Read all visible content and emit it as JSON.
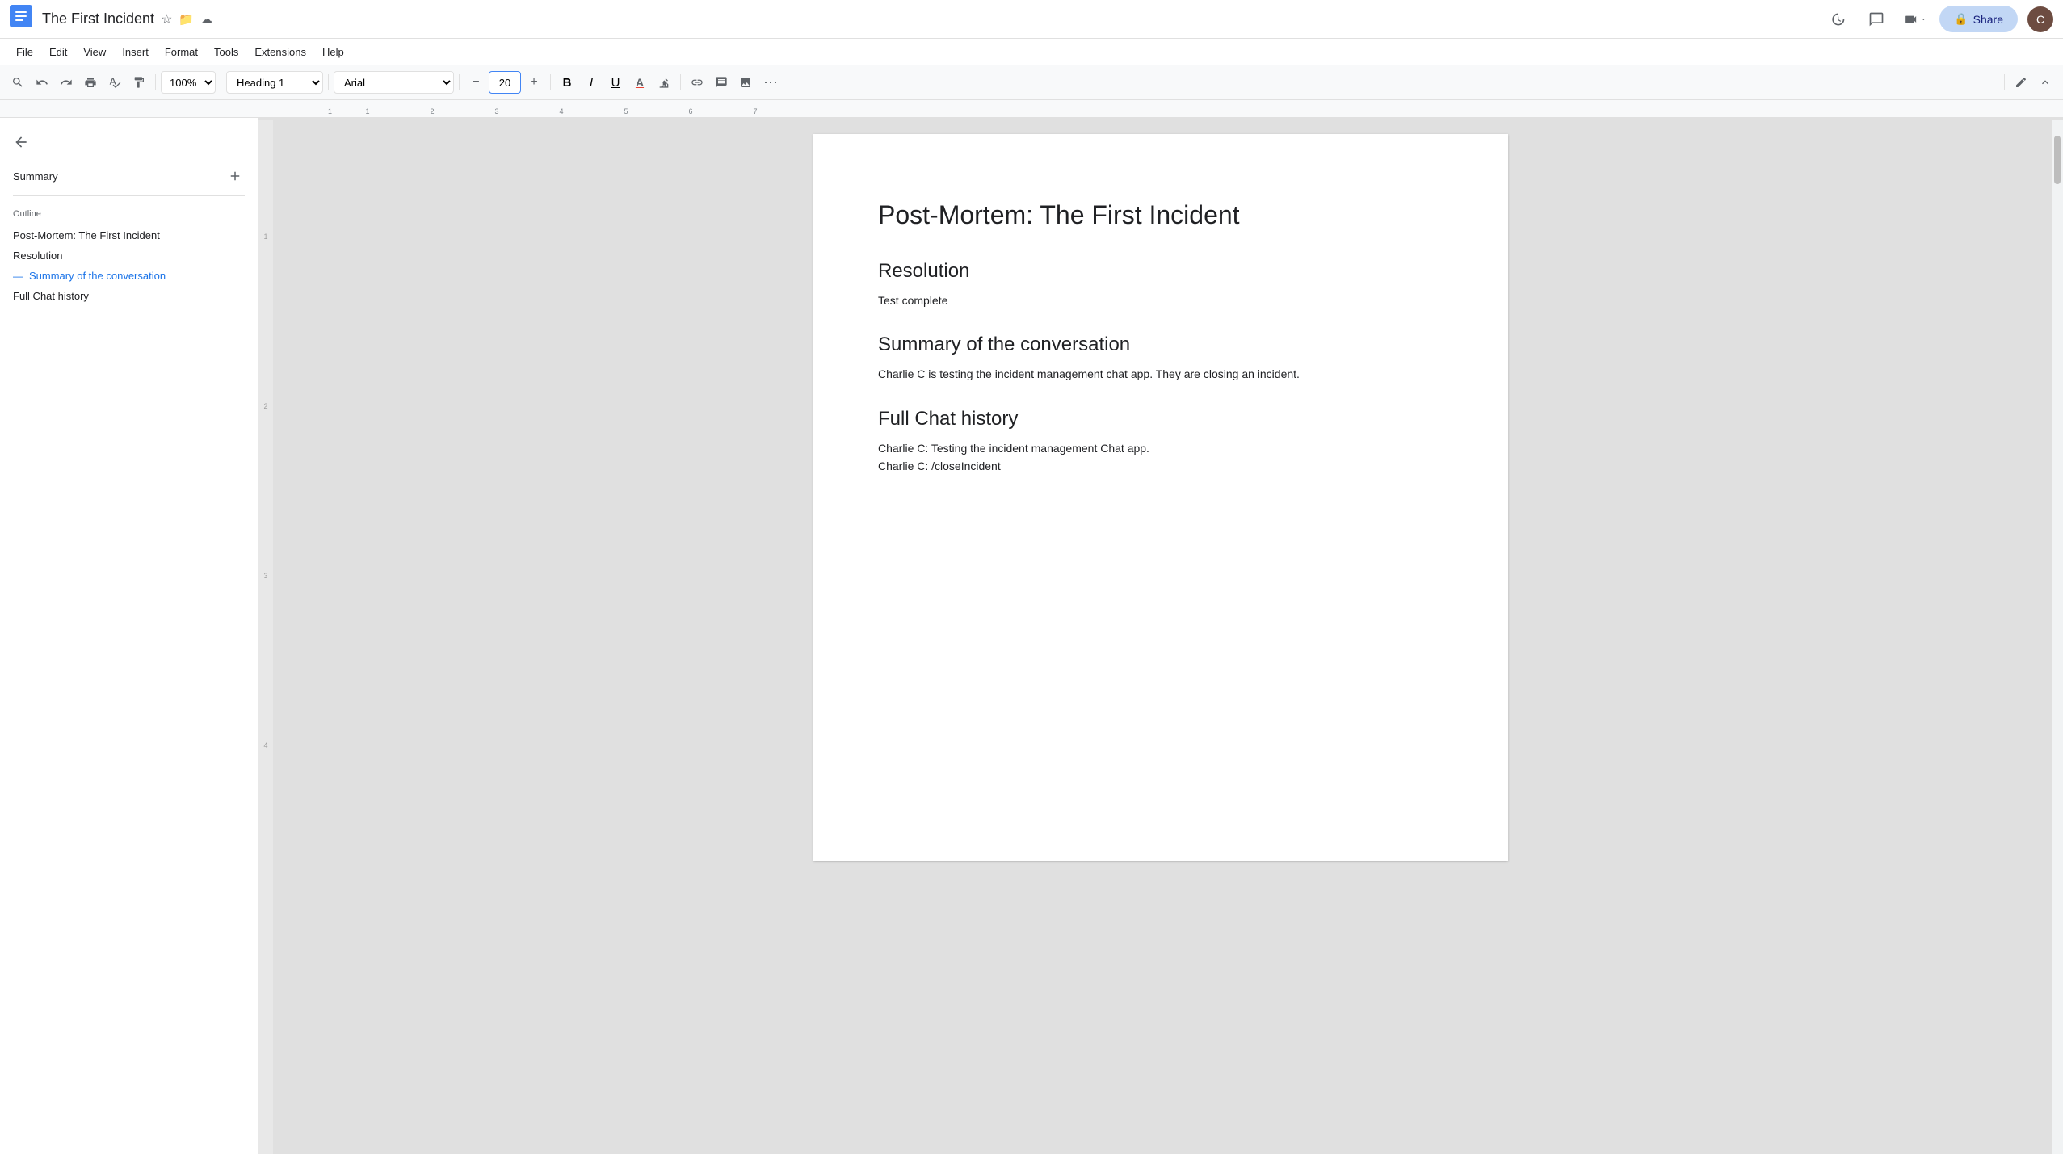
{
  "titlebar": {
    "doc_icon": "📄",
    "title": "The First Incident",
    "star_label": "☆",
    "folder_label": "📁",
    "cloud_label": "☁",
    "history_icon": "history",
    "comment_icon": "comment",
    "video_icon": "videocam",
    "share_label": "Share",
    "lock_icon": "🔒"
  },
  "menubar": {
    "items": [
      "File",
      "Edit",
      "View",
      "Insert",
      "Format",
      "Tools",
      "Extensions",
      "Help"
    ]
  },
  "toolbar": {
    "search_icon": "🔍",
    "undo_icon": "↩",
    "redo_icon": "↪",
    "print_icon": "🖨",
    "spellcheck_icon": "abc",
    "paint_icon": "🖌",
    "zoom_value": "100%",
    "style_value": "Heading 1",
    "font_value": "Arial",
    "font_size_value": "20",
    "decrease_font_icon": "−",
    "increase_font_icon": "+",
    "bold_label": "B",
    "italic_label": "I",
    "underline_label": "U",
    "text_color_icon": "A",
    "highlight_icon": "✏",
    "link_icon": "🔗",
    "comment_icon": "💬",
    "image_icon": "🖼",
    "more_icon": "⋯",
    "edit_icon": "✏",
    "collapse_icon": "⌃"
  },
  "sidebar": {
    "back_icon": "←",
    "summary_label": "Summary",
    "add_icon": "+",
    "outline_label": "Outline",
    "outline_items": [
      {
        "id": "post-mortem",
        "label": "Post-Mortem: The First Incident",
        "active": false
      },
      {
        "id": "resolution",
        "label": "Resolution",
        "active": false
      },
      {
        "id": "summary-conv",
        "label": "Summary of the conversation",
        "active": true
      },
      {
        "id": "full-chat",
        "label": "Full Chat history",
        "active": false
      }
    ]
  },
  "document": {
    "title": "Post-Mortem: The First Incident",
    "sections": [
      {
        "id": "resolution",
        "heading": "Resolution",
        "body": "Test complete"
      },
      {
        "id": "summary-conversation",
        "heading": "Summary of the conversation",
        "body": "Charlie C is testing the incident management chat app. They are closing an incident."
      },
      {
        "id": "full-chat-history",
        "heading": "Full Chat history",
        "lines": [
          "Charlie C: Testing the incident management Chat app.",
          "Charlie C: /closeIncident"
        ]
      }
    ]
  },
  "ruler": {
    "markers": [
      "1",
      "1",
      "2",
      "3",
      "4",
      "5",
      "6",
      "7"
    ]
  },
  "left_margin_numbers": [
    "1",
    "2",
    "3",
    "4"
  ],
  "colors": {
    "active_outline": "#1a73e8",
    "heading": "#202124",
    "body_text": "#202124",
    "toolbar_bg": "#f8f9fa",
    "share_bg": "#c2d7f5"
  }
}
